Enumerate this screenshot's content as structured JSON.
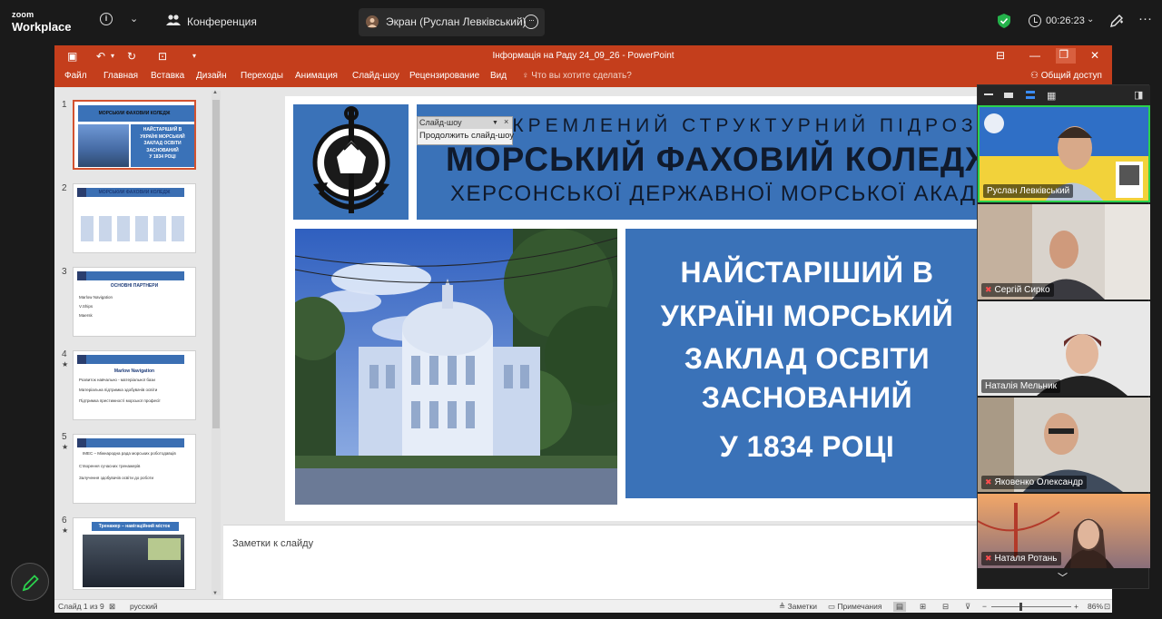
{
  "zoom": {
    "logo_line1": "zoom",
    "logo_line2": "Workplace",
    "info_icon": "i",
    "conference_label": "Конференция",
    "share_tab_label": "Экран (Руслан Левківський)",
    "timer": "00:26:23",
    "more_icon": "···"
  },
  "ppt": {
    "window_title": "Інформація на Раду 24_09_26 - PowerPoint",
    "menu": [
      "Файл",
      "Главная",
      "Вставка",
      "Дизайн",
      "Переходы",
      "Анимация",
      "Слайд-шоу",
      "Рецензирование",
      "Вид"
    ],
    "tell_me": "Что вы хотите сделать?",
    "share": "Общий доступ",
    "thumbnails": [
      {
        "num": "1",
        "star": false,
        "title": "МОРСЬКИЙ ФАХОВИЙ КОЛЕДЖ"
      },
      {
        "num": "2",
        "star": false,
        "title": "МОРСЬКИЙ ФАХОВИЙ КОЛЕДЖ"
      },
      {
        "num": "3",
        "star": false,
        "title": "ОСНОВНІ ПАРТНЕРИ"
      },
      {
        "num": "4",
        "star": true,
        "title": "Marlow Navigation"
      },
      {
        "num": "5",
        "star": true,
        "title": "IMEC – Міжнародна рада морських роботодавців"
      },
      {
        "num": "6",
        "star": true,
        "title": "Тренажер – навігаційний місток"
      }
    ],
    "thumb1": {
      "l1": "НАЙСТАРІШИЙ В",
      "l2": "УКРАЇНІ МОРСЬКИЙ",
      "l3": "ЗАКЛАД ОСВІТИ",
      "l4": "ЗАСНОВАНИЙ",
      "l5": "У 1834 РОЦІ"
    },
    "thumb3": {
      "p1": "Marlow Navigation",
      "p2": "V.Ships",
      "p3": "Maersk"
    },
    "thumb4": {
      "i1": "Розвиток навчально - матеріальної бази",
      "i2": "Матеріальна підтримка здобувачів освіти",
      "i3": "Підтримка престижності морської професії"
    },
    "thumb5": {
      "i1": "Створення сучасних тренажерів",
      "i2": "Залучення здобувачів освіти до роботи"
    },
    "slide": {
      "header_line1": "ВІДОКРЕМЛЕНИЙ СТРУКТУРНИЙ ПІДРОЗДІЛ",
      "header_line2": "МОРСЬКИЙ ФАХОВИЙ КОЛЕДЖ",
      "header_line3": "ХЕРСОНСЬКОЇ ДЕРЖАВНОЇ МОРСЬКОЇ АКАДЕМІЇ",
      "text_lines": [
        "НАЙСТАРІШИЙ В",
        "УКРАЇНІ МОРСЬКИЙ",
        "ЗАКЛАД ОСВІТИ",
        "ЗАСНОВАНИЙ",
        "У 1834 РОЦІ"
      ]
    },
    "slideshow_menu": {
      "title": "Слайд-шоу",
      "item": "Продолжить слайд-шоу"
    },
    "notes_placeholder": "Заметки к слайду",
    "status": {
      "slide_count": "Слайд 1 из 9",
      "language": "русский",
      "notes_btn": "Заметки",
      "comments_btn": "Примечания",
      "zoom": "86%",
      "zoom_fraction": 0.86
    }
  },
  "participants": [
    {
      "name": "Руслан Левківський",
      "muted": false
    },
    {
      "name": "Сергій Сирко",
      "muted": true
    },
    {
      "name": "Наталія Мельник",
      "muted": false
    },
    {
      "name": "Яковенко Олександр",
      "muted": true
    },
    {
      "name": "Наталя Ротань",
      "muted": true
    }
  ],
  "colors": {
    "ppt_red": "#c43e1c",
    "slide_blue": "#3a72b8",
    "zoom_bg": "#1a1a1a",
    "active_speaker": "#2bd14d"
  }
}
